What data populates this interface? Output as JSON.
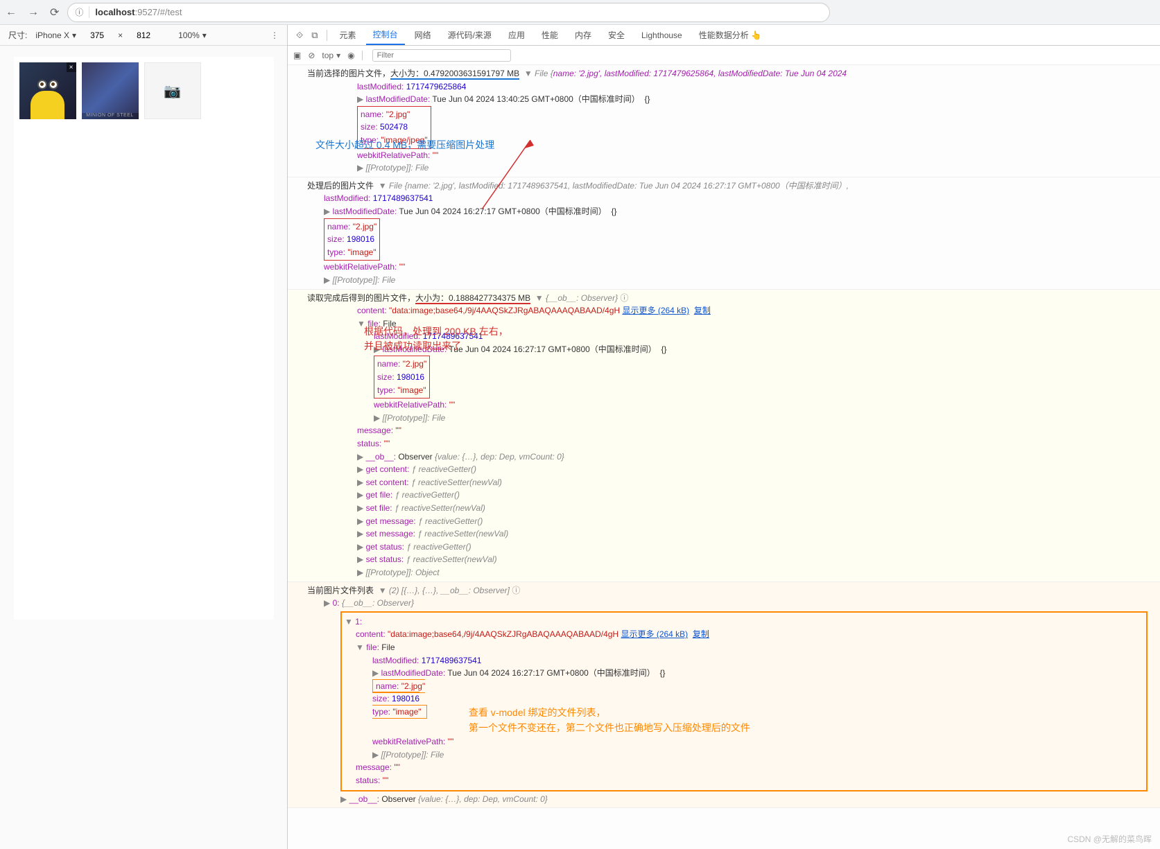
{
  "browser": {
    "url_host": "localhost",
    "url_port_path": ":9527/#/test"
  },
  "device_toolbar": {
    "dim_label": "尺寸:",
    "device": "iPhone X",
    "width": "375",
    "height": "812",
    "zoom": "100%",
    "times": "×"
  },
  "thumb2_label": "MINION OF STEEL",
  "devtools": {
    "tabs": [
      "元素",
      "控制台",
      "网络",
      "源代码/来源",
      "应用",
      "性能",
      "内存",
      "安全",
      "Lighthouse",
      "性能数据分析 👆"
    ],
    "top_label": "top",
    "filter_placeholder": "Filter"
  },
  "logs": {
    "log1": {
      "prefix": "当前选择的图片文件，",
      "size_label": "大小为：0.4792003631591797 MB",
      "file_kw": "File",
      "file_preview_name": "name: '2.jpg', ",
      "file_preview_lm": "lastModified: 1717479625864, ",
      "file_preview_lmd": "lastModifiedDate: Tue Jun 04 2024",
      "lastModified": "lastModified:",
      "lastModified_val": "1717479625864",
      "lastModifiedDate": "lastModifiedDate:",
      "lastModifiedDate_val": "Tue Jun 04 2024 13:40:25 GMT+0800（中国标准时间）",
      "name_k": "name:",
      "name_v": "\"2.jpg\"",
      "size_k": "size:",
      "size_v": "502478",
      "type_k": "type:",
      "type_v": "\"image/jpeg\"",
      "wrp_k": "webkitRelativePath:",
      "wrp_v": "\"\"",
      "proto": "[[Prototype]]: File",
      "brace": "{}"
    },
    "annotation1": "文件大小超过 0.4 MB，需要压缩图片处理",
    "log2": {
      "prefix": "处理后的图片文件",
      "file_kw": "File",
      "file_preview": "{name: '2.jpg', lastModified: 1717489637541, lastModifiedDate: Tue Jun 04 2024 16:27:17 GMT+0800（中国标准时间）, ",
      "lastModified_k": "lastModified:",
      "lastModified_v": "1717489637541",
      "lastModifiedDate_k": "lastModifiedDate:",
      "lastModifiedDate_v": "Tue Jun 04 2024 16:27:17 GMT+0800（中国标准时间）",
      "name_k": "name:",
      "name_v": "\"2.jpg\"",
      "size_k": "size:",
      "size_v": "198016",
      "type_k": "type:",
      "type_v": "\"image\"",
      "wrp_k": "webkitRelativePath:",
      "wrp_v": "\"\"",
      "proto": "[[Prototype]]: File",
      "brace": "{}"
    },
    "log3": {
      "prefix": "读取完成后得到的图片文件，",
      "size_label": "大小为：0.1888427734375 MB",
      "obj_preview": "{__ob__: Observer}",
      "content_k": "content:",
      "content_v": "\"data:image;base64,/9j/4AAQSkZJRgABAQAAAQABAAD/4gH",
      "content_more": "显示更多 (264 kB)",
      "content_copy": "复制",
      "file_k": "file:",
      "file_v": "File",
      "lastModified_k": "lastModified:",
      "lastModified_v": "1717489637541",
      "lastModifiedDate_k": "lastModifiedDate:",
      "lastModifiedDate_v": "Tue Jun 04 2024 16:27:17 GMT+0800（中国标准时间）",
      "name_k": "name:",
      "name_v": "\"2.jpg\"",
      "size_k": "size:",
      "size_v": "198016",
      "type_k": "type:",
      "type_v": "\"image\"",
      "wrp_k": "webkitRelativePath:",
      "wrp_v": "\"\"",
      "proto_file": "[[Prototype]]: File",
      "message_k": "message:",
      "message_v": "\"\"",
      "status_k": "status:",
      "status_v": "\"\"",
      "ob_k": "__ob__:",
      "ob_v": "Observer",
      "ob_preview": "{value: {…}, dep: Dep, vmCount: 0}",
      "get_content": "get content:",
      "set_content": "set content:",
      "get_file": "get file:",
      "set_file": "set file:",
      "get_message": "get message:",
      "set_message": "set message:",
      "get_status": "get status:",
      "set_status": "set status:",
      "reactiveGetter": "ƒ reactiveGetter()",
      "reactiveSetter": "ƒ reactiveSetter(newVal)",
      "proto_obj": "[[Prototype]]: Object",
      "brace": "{}",
      "info_i": "ⓘ"
    },
    "annotation3a": "根据代码，处理到 200 KB 左右，",
    "annotation3b": "并且被成功读取出来了",
    "log4": {
      "prefix": "当前图片文件列表",
      "arr_preview": "(2) [{…}, {…}, __ob__: Observer]",
      "idx0": "0:",
      "idx0_v": "{__ob__: Observer}",
      "idx1": "1:",
      "content_k": "content:",
      "content_v": "\"data:image;base64,/9j/4AAQSkZJRgABAQAAAQABAAD/4gH",
      "content_more": "显示更多 (264 kB)",
      "content_copy": "复制",
      "file_k": "file:",
      "file_v": "File",
      "lastModified_k": "lastModified:",
      "lastModified_v": "1717489637541",
      "lastModifiedDate_k": "lastModifiedDate:",
      "lastModifiedDate_v": "Tue Jun 04 2024 16:27:17 GMT+0800（中国标准时间）",
      "name_k": "name:",
      "name_v": "\"2.jpg\"",
      "size_k": "size:",
      "size_v": "198016",
      "type_k": "type:",
      "type_v": "\"image\"",
      "wrp_k": "webkitRelativePath:",
      "wrp_v": "\"\"",
      "proto_file": "[[Prototype]]: File",
      "message_k": "message:",
      "message_v": "\"\"",
      "status_k": "status:",
      "status_v": "\"\"",
      "ob_k": "__ob__:",
      "ob_v": "Observer",
      "ob_preview": "{value: {…}, dep: Dep, vmCount: 0}",
      "brace": "{}",
      "info_i": "ⓘ"
    },
    "annotation4a": "查看 v-model 绑定的文件列表，",
    "annotation4b": "第一个文件不变还在，第二个文件也正确地写入压缩处理后的文件"
  },
  "watermark": "CSDN @无解的菜鸟晖"
}
